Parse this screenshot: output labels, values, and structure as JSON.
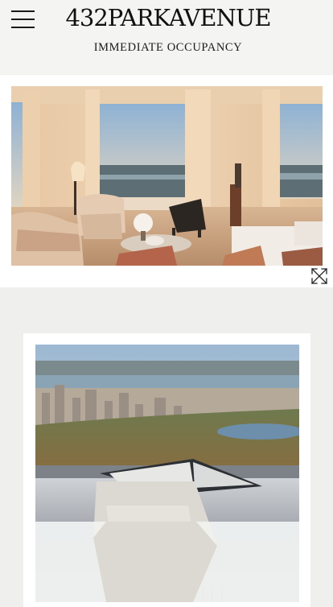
{
  "header": {
    "brand": "432PARKAVENUE",
    "subtitle": "IMMEDIATE OCCUPANCY",
    "menu_icon": "hamburger-menu-icon"
  },
  "gallery": {
    "expand_icon": "expand-arrows-icon",
    "images": [
      {
        "name": "living-room-photo",
        "subject": "living-room-with-view"
      },
      {
        "name": "central-park-view-photo",
        "subject": "window-seat-central-park"
      }
    ]
  },
  "colors": {
    "page_bg": "#efefee",
    "card_bg": "#ffffff",
    "text": "#111111"
  }
}
